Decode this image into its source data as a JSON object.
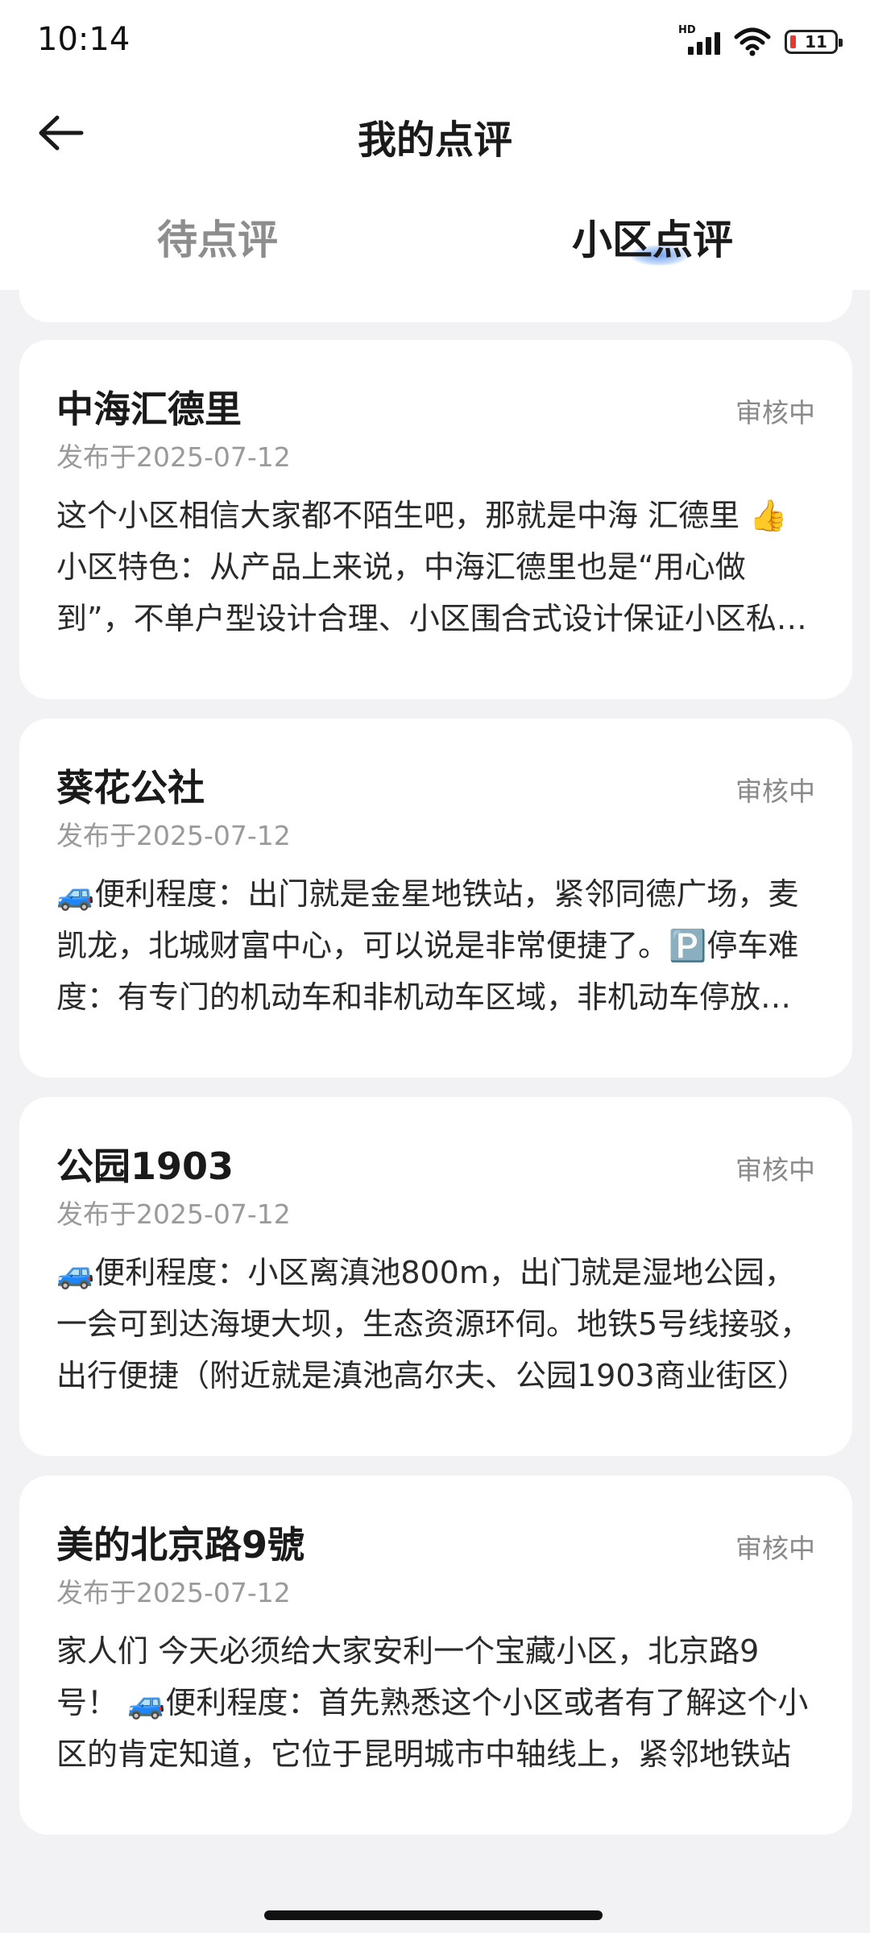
{
  "status_bar": {
    "time": "10:14",
    "network": "HD",
    "battery": "11",
    "icons": [
      "signal-icon",
      "wifi-icon",
      "battery-icon"
    ]
  },
  "header": {
    "title": "我的点评",
    "back_icon": "arrow-left-icon"
  },
  "tabs": [
    {
      "label": "待点评",
      "active": false
    },
    {
      "label": "小区点评",
      "active": true
    }
  ],
  "reviews": [
    {
      "name": "中海汇德里",
      "status": "审核中",
      "date": "发布于2025-07-12",
      "content": "这个小区相信大家都不陌生吧，那就是中海 汇德里 👍小区特色：从产品上来说，中海汇德里也是“用心做到”，不单户型设计合理、小区围合式设计保证小区私密性，楼间距也十分宽敞"
    },
    {
      "name": "葵花公社",
      "status": "审核中",
      "date": "发布于2025-07-12",
      "content": "🚙便利程度：出门就是金星地铁站，紧邻同德广场，麦凯龙，北城财富中心，可以说是非常便捷了。🅿️停车难度：有专门的机动车和非机动车区域，非机动车停放整齐"
    },
    {
      "name": "公园1903",
      "status": "审核中",
      "date": "发布于2025-07-12",
      "content": "🚙便利程度：小区离滇池800m，出门就是湿地公园，一会可到达海埂大坝，生态资源环伺。地铁5号线接驳，出行便捷（附近就是滇池高尔夫、公园1903商业街区）"
    },
    {
      "name": "美的北京路9號",
      "status": "审核中",
      "date": "发布于2025-07-12",
      "content": "家人们  今天必须给大家安利一个宝藏小区，北京路9号！ 🚙便利程度：首先熟悉这个小区或者有了解这个小区的肯定知道，它位于昆明城市中轴线上，紧邻地铁站"
    }
  ],
  "colors": {
    "background": "#f2f2f4",
    "card": "#ffffff",
    "tab_indicator": "#4682e6",
    "muted_text": "#9a9a9a"
  }
}
